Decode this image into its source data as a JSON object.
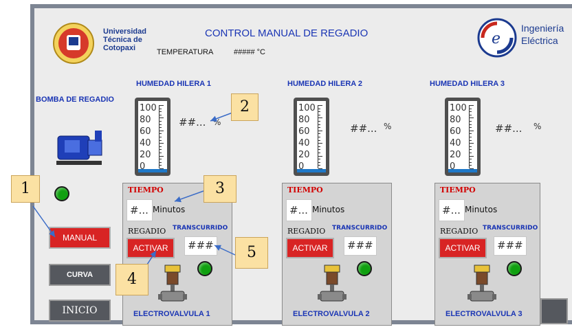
{
  "header": {
    "university": [
      "Universidad",
      "Técnica de",
      "Cotopaxi"
    ],
    "title": "CONTROL MANUAL DE REGADIO",
    "temperature_label": "TEMPERATURA",
    "temperature_value": "##### °C",
    "engineering": [
      "Ingeniería",
      "Eléctrica"
    ]
  },
  "pump": {
    "label": "BOMBA DE REGADIO"
  },
  "buttons": {
    "manual": "MANUAL",
    "curva": "CURVA",
    "inicio": "INICIO"
  },
  "gauge_ticks": [
    "100",
    "80",
    "60",
    "40",
    "20",
    "0"
  ],
  "rows": [
    {
      "humidity_title": "HUMEDAD HILERA 1",
      "humidity_value": "##...",
      "unit": "%",
      "fill": 0.05,
      "tiempo": "TIEMPO",
      "time_value": "#...",
      "minutes": "Minutos",
      "regadio": "REGADIO",
      "transcurrido": "TRANSCURRIDO",
      "activar": "ACTIVAR",
      "elapsed": "###",
      "valve_label": "ELECTROVALVULA 1"
    },
    {
      "humidity_title": "HUMEDAD HILERA 2",
      "humidity_value": "##...",
      "unit": "%",
      "fill": 0.05,
      "tiempo": "TIEMPO",
      "time_value": "#...",
      "minutes": "Minutos",
      "regadio": "REGADIO",
      "transcurrido": "TRANSCURRIDO",
      "activar": "ACTIVAR",
      "elapsed": "###",
      "valve_label": "ELECTROVALVULA 2"
    },
    {
      "humidity_title": "HUMEDAD HILERA 3",
      "humidity_value": "##...",
      "unit": "%",
      "fill": 0.05,
      "tiempo": "TIEMPO",
      "time_value": "#...",
      "minutes": "Minutos",
      "regadio": "REGADIO",
      "transcurrido": "TRANSCURRIDO",
      "activar": "ACTIVAR",
      "elapsed": "###",
      "valve_label": "ELECTROVALVULA 3"
    }
  ],
  "callouts": [
    "1",
    "2",
    "3",
    "4",
    "5"
  ],
  "colors": {
    "accent_blue": "#1a35b4",
    "button_red": "#d82424",
    "led_green": "#10a010",
    "gauge_fill": "#1e78c8"
  }
}
